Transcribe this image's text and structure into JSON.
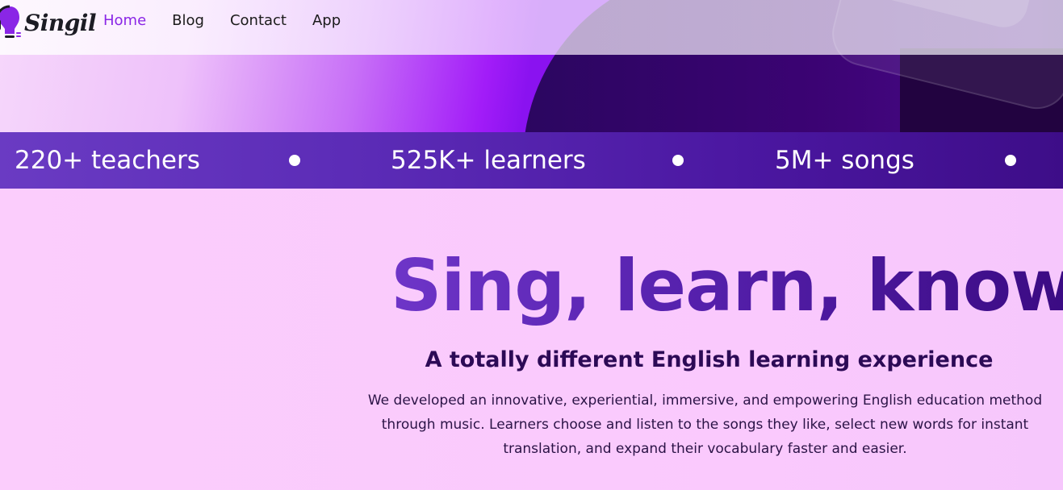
{
  "brand": {
    "name": "Singil"
  },
  "nav": {
    "items": [
      {
        "label": "Home",
        "active": true
      },
      {
        "label": "Blog",
        "active": false
      },
      {
        "label": "Contact",
        "active": false
      },
      {
        "label": "App",
        "active": false
      }
    ]
  },
  "stats": [
    {
      "label": "220+ teachers"
    },
    {
      "label": "525K+ learners"
    },
    {
      "label": "5M+ songs"
    }
  ],
  "hero": {
    "headline": "Sing, learn, know",
    "subheadline": "A totally different English learning experience",
    "description": "We developed an innovative, experiential, immersive, and empowering English education method through music. Learners choose and listen to the songs they like, select new words for instant translation, and expand their vocabulary faster and easier."
  },
  "colors": {
    "accent": "#8a26e6",
    "deep_purple": "#3a0a82",
    "background": "#fbc9fd"
  },
  "icons": {
    "logo": "lightbulb-headphones-icon"
  }
}
